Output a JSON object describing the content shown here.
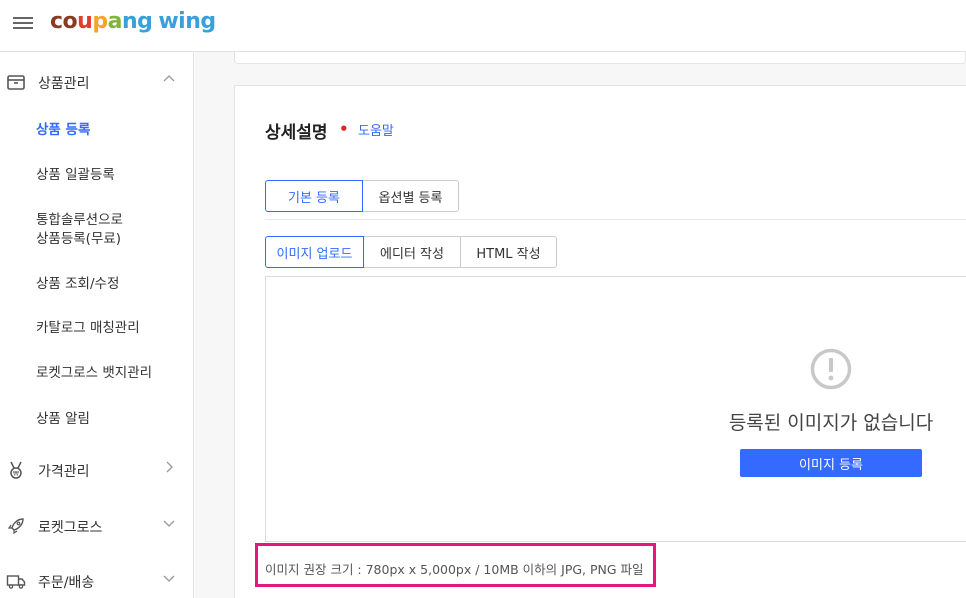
{
  "header": {
    "logo": {
      "part1": "co",
      "part2": "u",
      "part3": "p",
      "part4": "a",
      "part5": "ng",
      "wing": "wing"
    }
  },
  "sidebar": {
    "groups": [
      {
        "label": "상품관리",
        "icon": "box-icon",
        "state": "expanded"
      },
      {
        "label": "가격관리",
        "icon": "medal-icon",
        "state": "collapsed-right"
      },
      {
        "label": "로켓그로스",
        "icon": "rocket-icon",
        "state": "collapsed"
      },
      {
        "label": "주문/배송",
        "icon": "truck-icon",
        "state": "collapsed"
      }
    ],
    "product_items": [
      {
        "label": "상품 등록",
        "active": true
      },
      {
        "label": "상품 일괄등록"
      },
      {
        "label": "통합솔루션으로"
      },
      {
        "label": "상품등록(무료)"
      },
      {
        "label": "상품 조회/수정"
      },
      {
        "label": "카탈로그 매칭관리"
      },
      {
        "label": "로켓그로스 뱃지관리"
      },
      {
        "label": "상품 알림"
      }
    ]
  },
  "section": {
    "title": "상세설명",
    "required_mark": "•",
    "help_link": "도움말"
  },
  "registration_tabs": [
    {
      "label": "기본 등록",
      "active": true
    },
    {
      "label": "옵션별 등록"
    }
  ],
  "editor_tabs": [
    {
      "label": "이미지 업로드",
      "active": true
    },
    {
      "label": "에디터 작성"
    },
    {
      "label": "HTML 작성"
    }
  ],
  "upload": {
    "empty_message": "등록된 이미지가 없습니다",
    "button_label": "이미지 등록"
  },
  "notice": {
    "text": "이미지 권장 크기 : 780px x 5,000px / 10MB 이하의 JPG, PNG 파일"
  },
  "colors": {
    "accent": "#346aff",
    "required": "#e52528",
    "highlight_border": "#e5177a"
  }
}
